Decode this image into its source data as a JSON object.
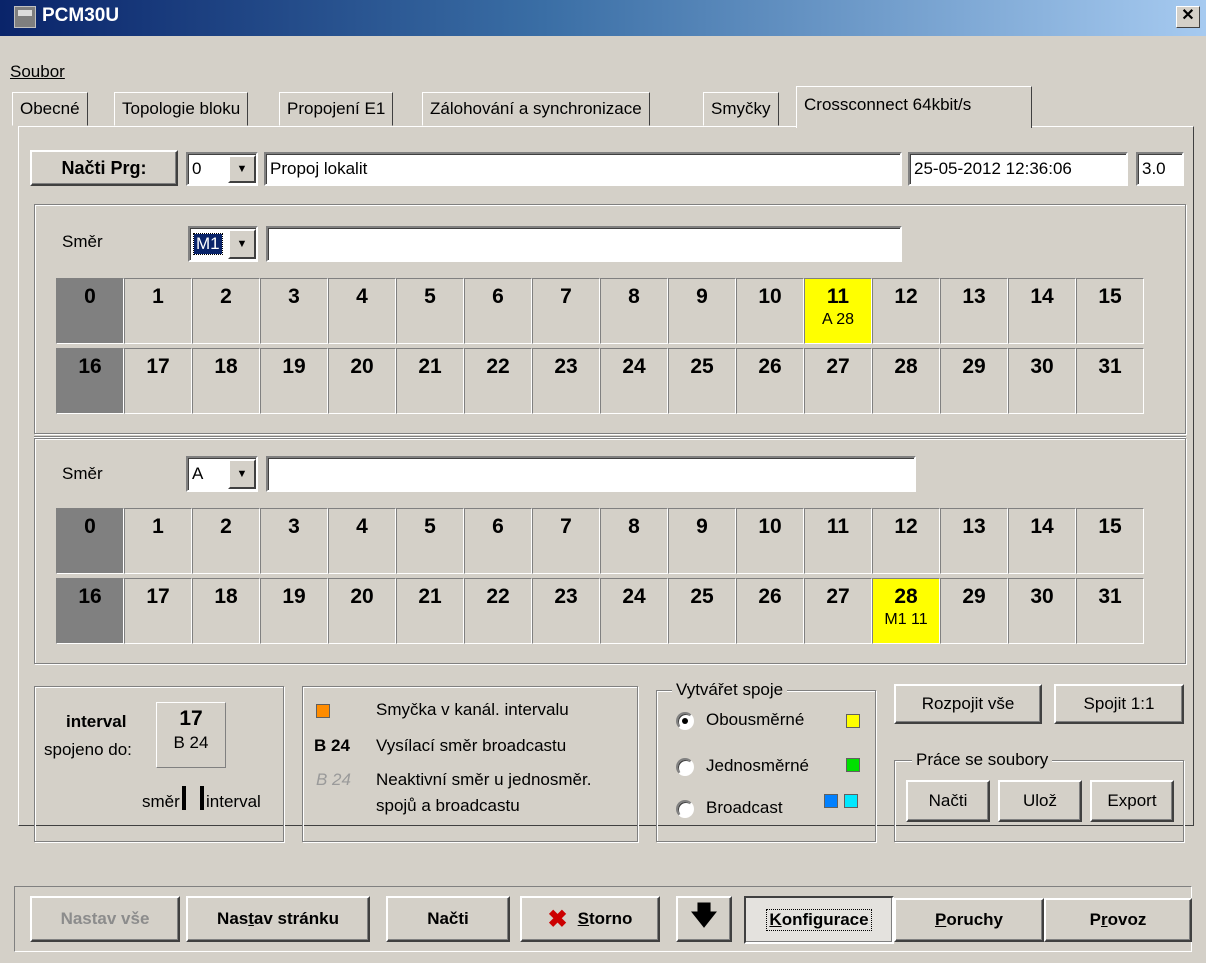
{
  "window": {
    "title": "PCM30U",
    "close_glyph": "✕"
  },
  "menu": {
    "soubor": "Soubor"
  },
  "tabs": [
    {
      "label": "Obecné"
    },
    {
      "label": "Topologie bloku"
    },
    {
      "label": "Propojení E1"
    },
    {
      "label": "Zálohování a synchronizace"
    },
    {
      "label": "Smyčky"
    },
    {
      "label": "Crossconnect 64kbit/s"
    }
  ],
  "program": {
    "load_label": "Načti Prg:",
    "number": "0",
    "name": "Propoj lokalit",
    "datetime": "25-05-2012 12:36:06",
    "version": "3.0"
  },
  "direction1": {
    "label": "Směr",
    "value": "M1",
    "text": "",
    "row1": [
      {
        "n": "0",
        "style": "dark"
      },
      {
        "n": "1"
      },
      {
        "n": "2"
      },
      {
        "n": "3"
      },
      {
        "n": "4"
      },
      {
        "n": "5"
      },
      {
        "n": "6"
      },
      {
        "n": "7"
      },
      {
        "n": "8"
      },
      {
        "n": "9"
      },
      {
        "n": "10"
      },
      {
        "n": "11",
        "style": "yel",
        "sub": "A  28"
      },
      {
        "n": "12"
      },
      {
        "n": "13"
      },
      {
        "n": "14"
      },
      {
        "n": "15"
      }
    ],
    "row2": [
      {
        "n": "16",
        "style": "dark"
      },
      {
        "n": "17"
      },
      {
        "n": "18"
      },
      {
        "n": "19"
      },
      {
        "n": "20"
      },
      {
        "n": "21"
      },
      {
        "n": "22"
      },
      {
        "n": "23"
      },
      {
        "n": "24"
      },
      {
        "n": "25"
      },
      {
        "n": "26"
      },
      {
        "n": "27"
      },
      {
        "n": "28"
      },
      {
        "n": "29"
      },
      {
        "n": "30"
      },
      {
        "n": "31"
      }
    ]
  },
  "direction2": {
    "label": "Směr",
    "value": "A",
    "text": "",
    "row1": [
      {
        "n": "0",
        "style": "dark"
      },
      {
        "n": "1"
      },
      {
        "n": "2"
      },
      {
        "n": "3"
      },
      {
        "n": "4"
      },
      {
        "n": "5"
      },
      {
        "n": "6"
      },
      {
        "n": "7"
      },
      {
        "n": "8"
      },
      {
        "n": "9"
      },
      {
        "n": "10"
      },
      {
        "n": "11"
      },
      {
        "n": "12"
      },
      {
        "n": "13"
      },
      {
        "n": "14"
      },
      {
        "n": "15"
      }
    ],
    "row2": [
      {
        "n": "16",
        "style": "dark"
      },
      {
        "n": "17"
      },
      {
        "n": "18"
      },
      {
        "n": "19"
      },
      {
        "n": "20"
      },
      {
        "n": "21"
      },
      {
        "n": "22"
      },
      {
        "n": "23"
      },
      {
        "n": "24"
      },
      {
        "n": "25"
      },
      {
        "n": "26"
      },
      {
        "n": "27"
      },
      {
        "n": "28",
        "style": "yel",
        "sub": "M1 11"
      },
      {
        "n": "29"
      },
      {
        "n": "30"
      },
      {
        "n": "31"
      }
    ]
  },
  "info": {
    "interval_label": "interval",
    "interval_value": "17",
    "connected_label": "spojeno do:",
    "connected_value": "B  24",
    "dir_label": "směr",
    "interval_small_label": "interval"
  },
  "legend": {
    "loop_text": "Smyčka v kanál. intervalu",
    "loop_color": "#ff8c00",
    "b24_bold": "B 24",
    "b24_text": "Vysílací směr broadcastu",
    "b24_inactive": "B 24",
    "inactive_text_1": "Neaktivní směr u jednosměr.",
    "inactive_text_2": "spojů a broadcastu"
  },
  "create": {
    "title": "Vytvářet spoje",
    "options": [
      {
        "label": "Obousměrné",
        "checked": true,
        "color1": "#ffff00"
      },
      {
        "label": "Jednosměrné",
        "checked": false,
        "color1": "#00e000"
      },
      {
        "label": "Broadcast",
        "checked": false,
        "color1": "#0080ff",
        "color2": "#00e8ff"
      }
    ]
  },
  "actions": {
    "disconnect_all": "Rozpojit vše",
    "connect_1_1": "Spojit 1:1",
    "files_title": "Práce se soubory",
    "load": "Načti",
    "save": "Ulož",
    "export": "Export"
  },
  "bottom": {
    "set_all": "Nastav vše",
    "set_page_a": "Nas",
    "set_page_u": "t",
    "set_page_b": "av stránku",
    "load": "Načti",
    "cancel_icon": "✖",
    "cancel_u": "S",
    "cancel_rest": "torno",
    "down_icon": "🡇",
    "config_u": "K",
    "config_rest": "onfigurace",
    "faults_u": "P",
    "faults_rest": "oruchy",
    "oper_a": "P",
    "oper_u": "r",
    "oper_b": "ovoz"
  }
}
